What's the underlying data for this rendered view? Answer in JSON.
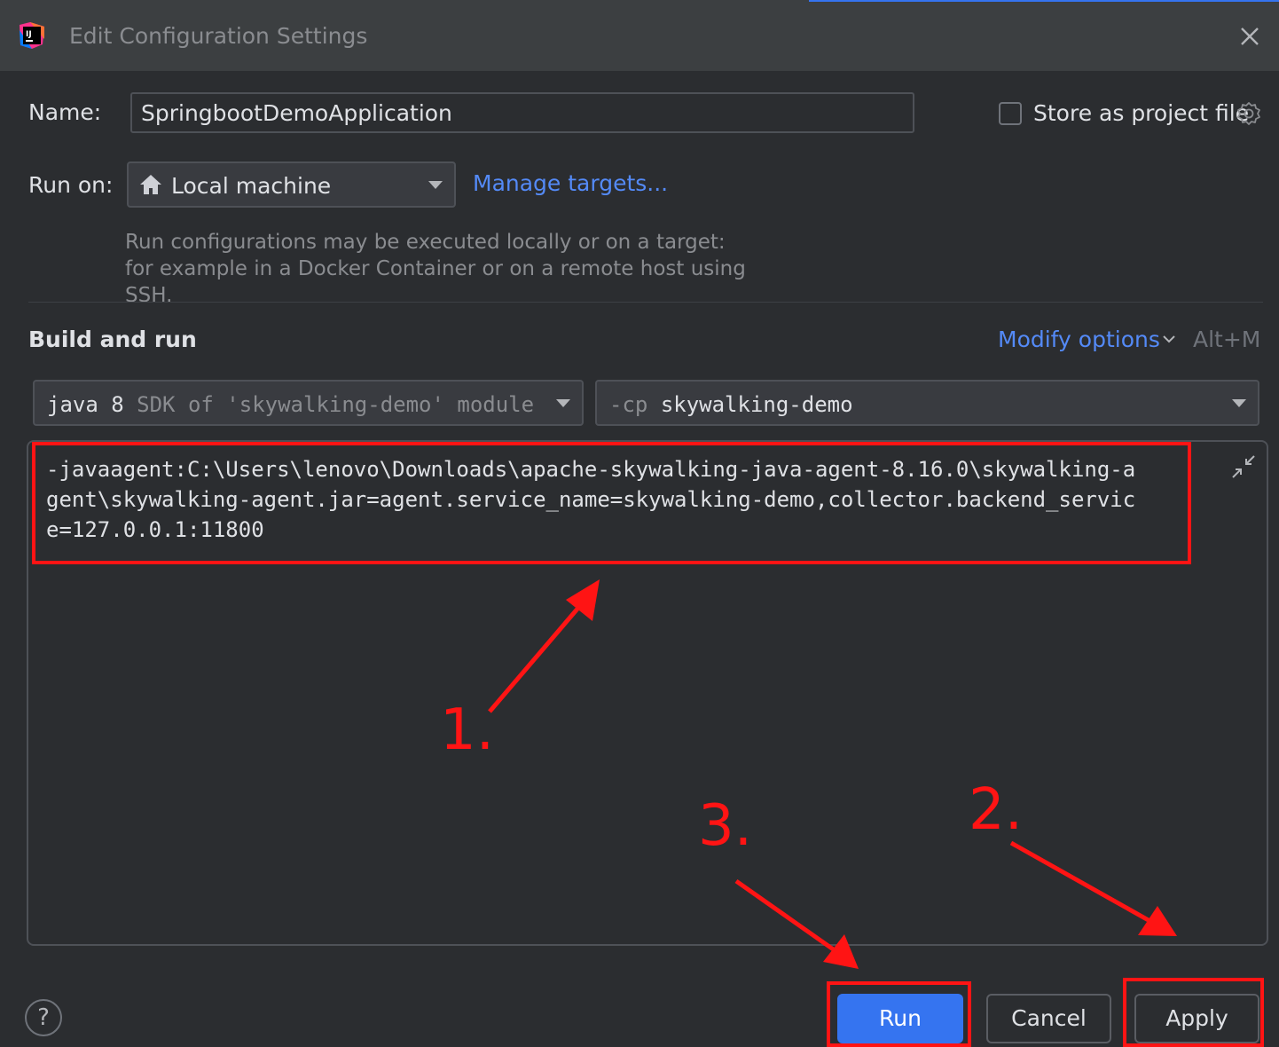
{
  "window": {
    "title": "Edit Configuration Settings"
  },
  "form": {
    "name_label": "Name:",
    "name_value": "SpringbootDemoApplication",
    "store_label": "Store as project file",
    "run_on_label": "Run on:",
    "run_on_value": "Local machine",
    "manage_targets": "Manage targets...",
    "help_text": "Run configurations may be executed locally or on a target: for example in a Docker Container or on a remote host using SSH."
  },
  "build_and_run": {
    "section_title": "Build and run",
    "modify_options": "Modify options",
    "modify_shortcut": "Alt+M",
    "sdk_main": "java 8",
    "sdk_sub": "SDK of 'skywalking-demo' module",
    "cp_prefix": "-cp",
    "cp_value": "skywalking-demo",
    "vm_options": "-javaagent:C:\\Users\\lenovo\\Downloads\\apache-skywalking-java-agent-8.16.0\\skywalking-agent\\skywalking-agent.jar=agent.service_name=skywalking-demo,collector.backend_service=127.0.0.1:11800"
  },
  "footer": {
    "help": "?",
    "run": "Run",
    "cancel": "Cancel",
    "apply": "Apply"
  },
  "annotations": {
    "step1": "1.",
    "step2": "2.",
    "step3": "3."
  },
  "colors": {
    "accent": "#3574f0",
    "link": "#548af7",
    "annotation": "#ff1414"
  }
}
